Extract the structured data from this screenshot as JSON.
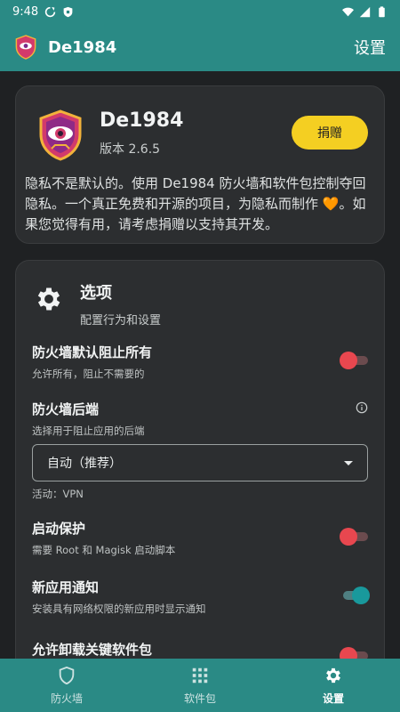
{
  "statusbar": {
    "time": "9:48"
  },
  "appbar": {
    "title": "De1984",
    "screen_title": "设置"
  },
  "about": {
    "name": "De1984",
    "version": "版本 2.6.5",
    "donate_label": "捐赠",
    "desc_part1": "隐私不是默认的。使用 De1984 防火墙和软件包控制夺回隐私。一个真正免费和开源的项目，为隐私而制作 ",
    "desc_heart": "🧡",
    "desc_part2": "。如果您觉得有用，请考虑捐赠以支持其开发。"
  },
  "options": {
    "title": "选项",
    "subtitle": "配置行为和设置",
    "firewall_default": {
      "label": "防火墙默认阻止所有",
      "hint": "允许所有，阻止不需要的",
      "enabled": false
    },
    "firewall_backend": {
      "label": "防火墙后端",
      "hint": "选择用于阻止应用的后端",
      "selected": "自动（推荐）",
      "active": "活动：VPN"
    },
    "boot_protection": {
      "label": "启动保护",
      "hint": "需要 Root 和 Magisk 启动脚本",
      "enabled": false
    },
    "new_app_notify": {
      "label": "新应用通知",
      "hint": "安装具有网络权限的新应用时显示通知",
      "enabled": true
    },
    "allow_uninstall": {
      "label": "允许卸载关键软件包",
      "enabled": false
    }
  },
  "bottom_nav": {
    "firewall": "防火墙",
    "packages": "软件包",
    "settings": "设置",
    "active": "settings"
  },
  "colors": {
    "accent": "#2a8a85",
    "donate": "#f4cf22",
    "toggle_off": "#e8474f",
    "toggle_on": "#19999c"
  }
}
